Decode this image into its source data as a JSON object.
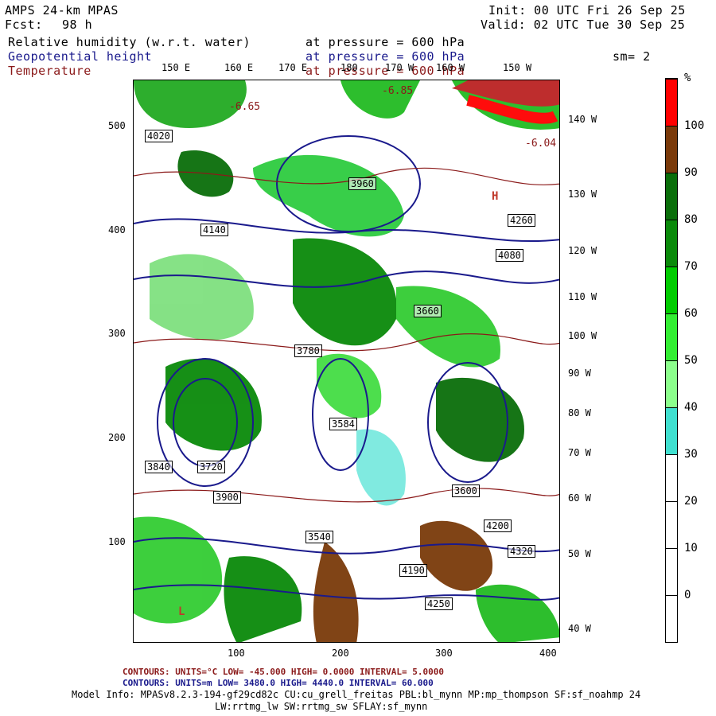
{
  "header": {
    "model": "AMPS 24-km MPAS",
    "init": "Init: 00 UTC Fri 26 Sep 25",
    "fcst_label": "Fcst:",
    "fcst_value": "98 h",
    "valid": "Valid: 02 UTC Tue 30 Sep 25",
    "field1": "Relative humidity (w.r.t. water)",
    "field1_level": "at pressure =  600 hPa",
    "field2": "Geopotential height",
    "field2_level": "at pressure =  600 hPa",
    "field3": "Temperature",
    "field3_level": "at pressure =  600 hPa",
    "smoothing": "sm= 2"
  },
  "axes": {
    "x_ticks": [
      "100",
      "200",
      "300",
      "400"
    ],
    "y_ticks": [
      "500",
      "400",
      "300",
      "200",
      "100"
    ]
  },
  "longitude_labels": {
    "top": [
      "150 E",
      "160 E",
      "170 E",
      "180",
      "170 W",
      "160 W",
      "150 W"
    ],
    "right": [
      "140 W",
      "130 W",
      "120 W",
      "110 W",
      "100 W",
      "90 W",
      "80 W",
      "70 W",
      "60 W",
      "50 W",
      "40 W"
    ]
  },
  "colorbar": {
    "unit": "%",
    "labels": [
      "100",
      "90",
      "80",
      "70",
      "60",
      "50",
      "40",
      "30",
      "20",
      "10",
      "0"
    ],
    "colors": [
      "#ff0000",
      "#7a3a0a",
      "#0a6e0a",
      "#0a8a0a",
      "#00cc00",
      "#33ee33",
      "#8cff8c",
      "#40e0d0",
      "#ffffff",
      "#ffffff",
      "#ffffff",
      "#ffffff"
    ]
  },
  "map_labels": {
    "height_contours": [
      "4020",
      "4260",
      "4140",
      "4080",
      "3960",
      "3840",
      "3720",
      "3900",
      "3600",
      "3780",
      "4200",
      "4320",
      "3660",
      "3540",
      "3584",
      "4190",
      "4250"
    ],
    "temperature_contours": [
      "-6.65",
      "-6.85",
      "-6.04"
    ],
    "highs_lows": [
      "H",
      "L"
    ]
  },
  "footer": {
    "temp_contours": "CONTOURS:  UNITS=°C  LOW= -45.000      HIGH=  0.0000      INTERVAL=   5.0000",
    "height_contours": "CONTOURS:  UNITS=m  LOW=  3480.0      HIGH=  4440.0      INTERVAL=   60.000",
    "model_info": "Model Info: MPASv8.2.3-194-gf29cd82c CU:cu_grell_freitas PBL:bl_mynn MP:mp_thompson SF:sf_noahmp 24",
    "model_info2": "LW:rrtmg_lw SW:rrtmg_sw SFLAY:sf_mynn"
  }
}
